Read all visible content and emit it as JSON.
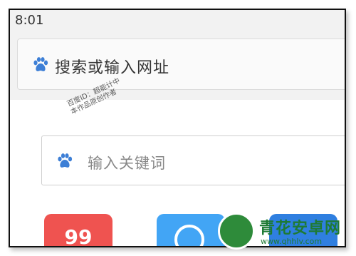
{
  "status_bar": {
    "time": "8:01"
  },
  "address_bar": {
    "placeholder": "搜索或输入网址",
    "icon": "baidu-paw-icon"
  },
  "search_box": {
    "placeholder": "输入关键词",
    "icon": "baidu-paw-icon"
  },
  "watermark": {
    "line1": "百度ID：超能计中",
    "line2": "本作品原创作者"
  },
  "shortcuts": [
    {
      "label": "99",
      "color": "#ef5350"
    },
    {
      "icon": "compass-icon",
      "color": "#42a5f5"
    },
    {
      "color": "#2f7fe0"
    }
  ],
  "brand": {
    "title": "青花安卓网",
    "url": "www.qhhlv.com"
  },
  "colors": {
    "paw": "#3d7fd6",
    "frame": "#111111"
  }
}
